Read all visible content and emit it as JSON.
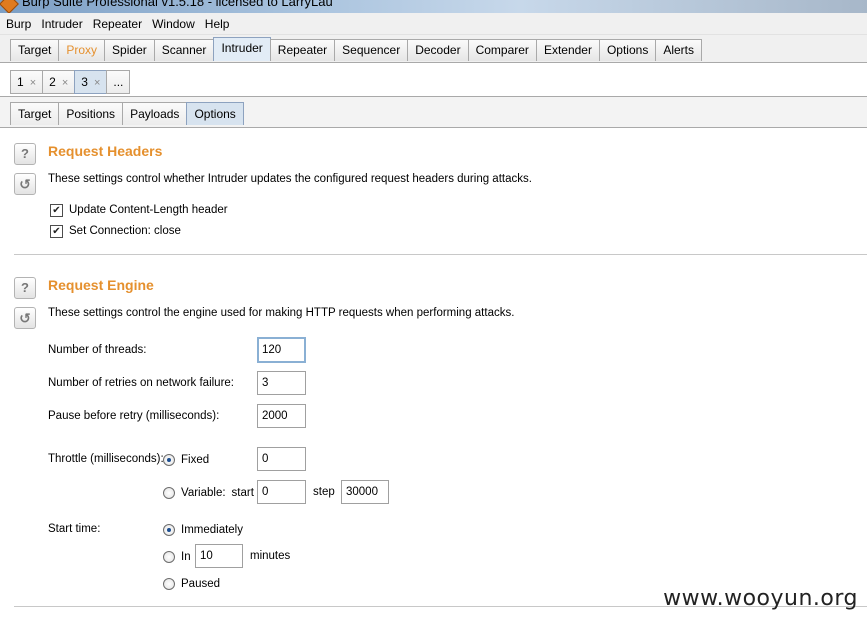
{
  "window": {
    "title": "Burp Suite Professional v1.5.18 - licensed to LarryLau"
  },
  "menu": [
    "Burp",
    "Intruder",
    "Repeater",
    "Window",
    "Help"
  ],
  "main_tabs": [
    "Target",
    "Proxy",
    "Spider",
    "Scanner",
    "Intruder",
    "Repeater",
    "Sequencer",
    "Decoder",
    "Comparer",
    "Extender",
    "Options",
    "Alerts"
  ],
  "main_tab_selected": "Intruder",
  "attack_tabs": [
    {
      "label": "1",
      "close": "×"
    },
    {
      "label": "2",
      "close": "×"
    },
    {
      "label": "3",
      "close": "×"
    },
    {
      "label": "...",
      "close": ""
    }
  ],
  "sub_tabs": [
    "Target",
    "Positions",
    "Payloads",
    "Options"
  ],
  "sub_tab_selected": "Options",
  "icons": {
    "help": "?",
    "restore": "↺",
    "check": "✔"
  },
  "request_headers": {
    "title": "Request Headers",
    "description": "These settings control whether Intruder updates the configured request headers during attacks.",
    "update_content_length": {
      "label": "Update Content-Length header",
      "checked": true
    },
    "set_connection_close": {
      "label": "Set Connection: close",
      "checked": true
    }
  },
  "request_engine": {
    "title": "Request Engine",
    "description": "These settings control the engine used for making HTTP requests when performing attacks.",
    "threads": {
      "label": "Number of threads:",
      "value": "120"
    },
    "retries": {
      "label": "Number of retries on network failure:",
      "value": "3"
    },
    "pause": {
      "label": "Pause before retry (milliseconds):",
      "value": "2000"
    },
    "throttle": {
      "label": "Throttle (milliseconds):",
      "fixed_label": "Fixed",
      "fixed_value": "0",
      "variable_label": "Variable:",
      "start_label": "start",
      "start_value": "0",
      "step_label": "step",
      "step_value": "30000",
      "selected": "fixed"
    },
    "start_time": {
      "label": "Start time:",
      "immediately_label": "Immediately",
      "in_label": "In",
      "in_value": "10",
      "minutes_label": "minutes",
      "paused_label": "Paused",
      "selected": "immediately"
    }
  },
  "watermark": "www.wooyun.org"
}
